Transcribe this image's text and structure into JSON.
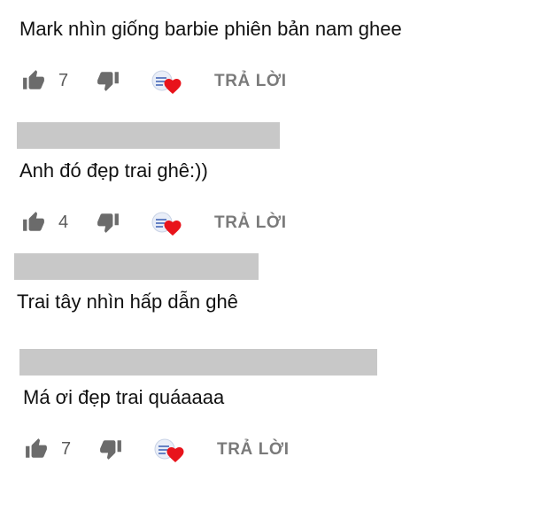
{
  "comments": [
    {
      "text": "Mark nhìn giống barbie phiên bản nam ghee",
      "likes": "7",
      "reply_label": "TRẢ LỜI",
      "creator_heart": true
    },
    {
      "text": "Anh đó đẹp trai ghê:))",
      "likes": "4",
      "reply_label": "TRẢ LỜI",
      "creator_heart": true
    },
    {
      "text": "Trai tây nhìn hấp dẫn ghê"
    },
    {
      "text": "Má ơi đẹp trai quáaaaa",
      "likes": "7",
      "reply_label": "TRẢ LỜI",
      "creator_heart": true
    }
  ],
  "icons": {
    "like": "thumb-up-icon",
    "dislike": "thumb-down-icon",
    "heart": "heart-icon"
  },
  "colors": {
    "redaction": "#c8c8c8",
    "heart": "#e8131b",
    "icon": "#6b6b6b"
  }
}
